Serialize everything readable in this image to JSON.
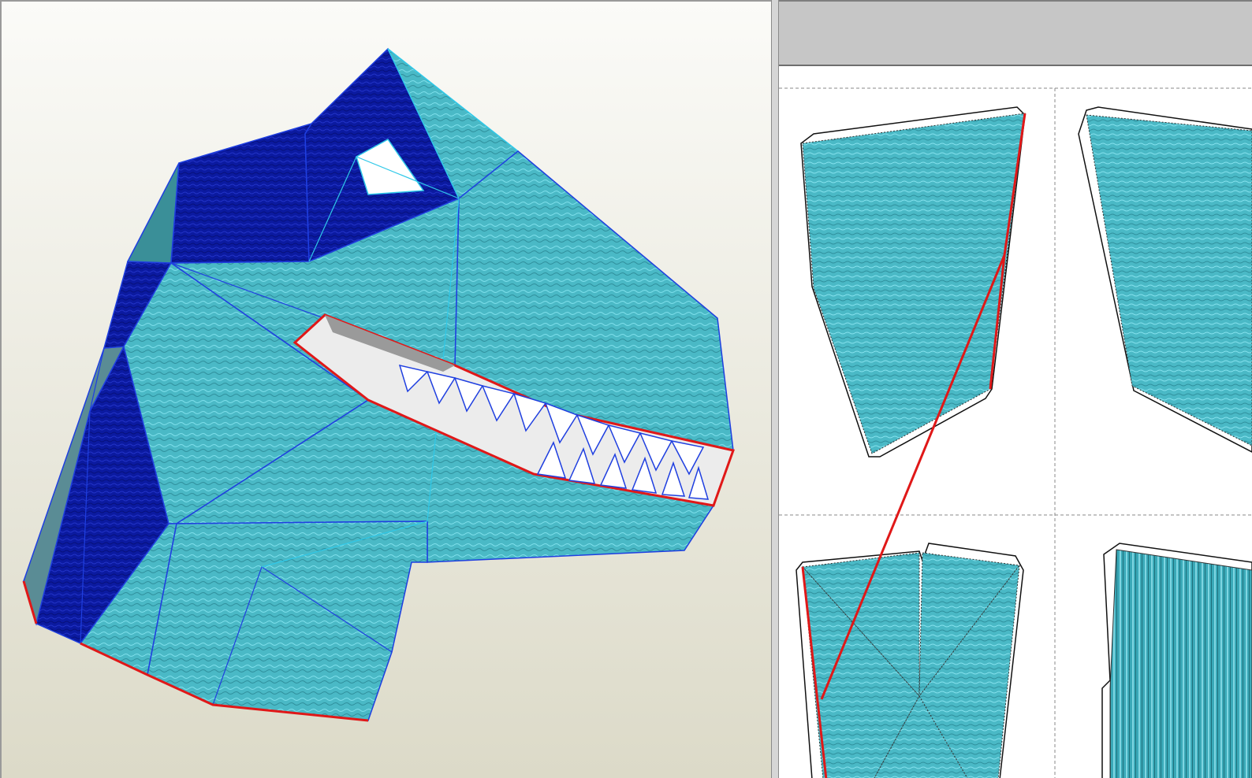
{
  "app": {
    "view_3d_label": "",
    "view_2d_label": "",
    "toolbar_2d_label": ""
  },
  "colors": {
    "teal_face": "#4ab9c6",
    "dark_face": "#0a1a9e",
    "edge_blue": "#1f3fe0",
    "edge_cyan": "#2fc8e8",
    "cut_red": "#e01818",
    "inner_mouth": "#eeeeee",
    "sheet_background": "#ffffff",
    "page_separator": "#888888"
  },
  "icons": []
}
